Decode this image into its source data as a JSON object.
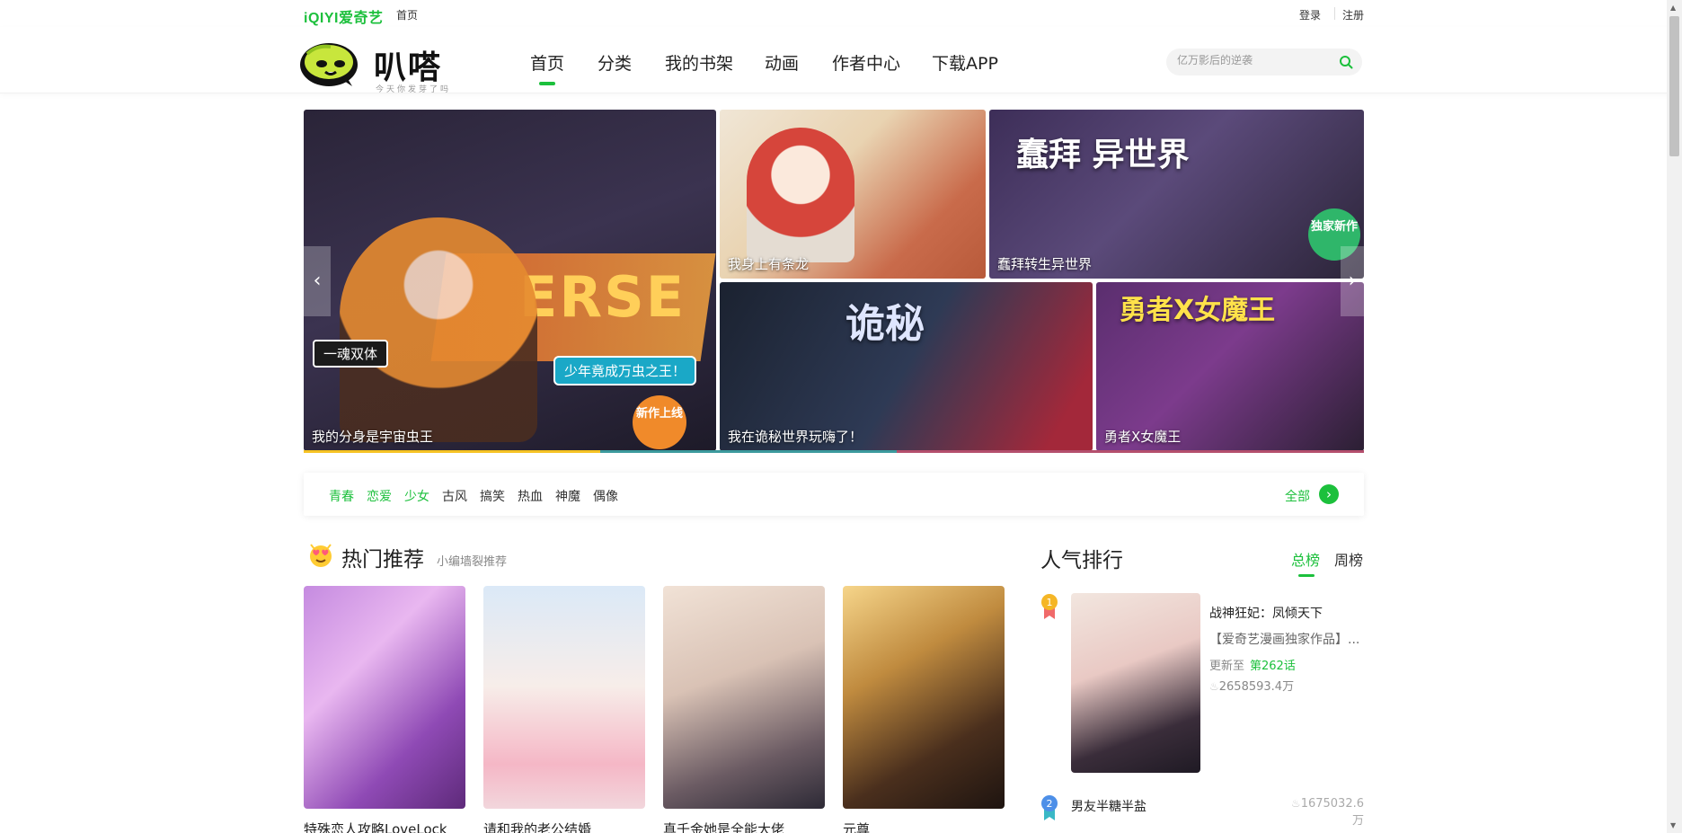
{
  "topbar": {
    "brand": "iQIYI爱奇艺",
    "home": "首页",
    "login": "登录",
    "register": "注册"
  },
  "header": {
    "brand_word": "叭嗒",
    "brand_slogan": "今天你发芽了吗",
    "nav": [
      "首页",
      "分类",
      "我的书架",
      "动画",
      "作者中心",
      "下载APP"
    ],
    "search_placeholder": "亿万影后的逆袭"
  },
  "banner": {
    "slides": [
      {
        "caption": "我的分身是宇宙虫王",
        "art": "ERSE",
        "tag1": "一魂双体",
        "tag2": "少年竟成万虫之王！",
        "badge": "新作上线"
      },
      {
        "caption": "我身上有条龙"
      },
      {
        "caption": "蠢拜转生异世界",
        "art": "蠢拜 异世界",
        "badge": "独家新作"
      },
      {
        "caption": "我在诡秘世界玩嗨了！",
        "art": "诡秘"
      },
      {
        "caption": "勇者X女魔王",
        "art": "勇者X女魔王"
      }
    ],
    "progress_colors": [
      "#f6c324",
      "#3c9a9d",
      "#b44f6d"
    ]
  },
  "genres": {
    "items": [
      {
        "label": "青春",
        "highlight": true
      },
      {
        "label": "恋爱",
        "highlight": true
      },
      {
        "label": "少女",
        "highlight": true
      },
      {
        "label": "古风",
        "highlight": false
      },
      {
        "label": "搞笑",
        "highlight": false
      },
      {
        "label": "热血",
        "highlight": false
      },
      {
        "label": "神魔",
        "highlight": false
      },
      {
        "label": "偶像",
        "highlight": false
      }
    ],
    "all": "全部"
  },
  "hot": {
    "title": "热门推荐",
    "subtitle": "小编墙裂推荐",
    "cards": [
      {
        "title": "特殊恋人攻略LoveLock"
      },
      {
        "title": "请和我的老公结婚"
      },
      {
        "title": "真千金她是全能大佬"
      },
      {
        "title": "元尊"
      }
    ]
  },
  "ranking": {
    "title": "人气排行",
    "tabs": [
      "总榜",
      "周榜"
    ],
    "first": {
      "rank": "1",
      "name": "战神狂妃：凤倾天下",
      "desc": "【爱奇艺漫画独家作品】...",
      "update_prefix": "更新至",
      "chapter": "第262话",
      "hot": "2658593.4万"
    },
    "second": {
      "rank": "2",
      "name": "男友半糖半盐",
      "hot": "1675032.6万"
    }
  },
  "colors": {
    "accent": "#1cc03c"
  }
}
